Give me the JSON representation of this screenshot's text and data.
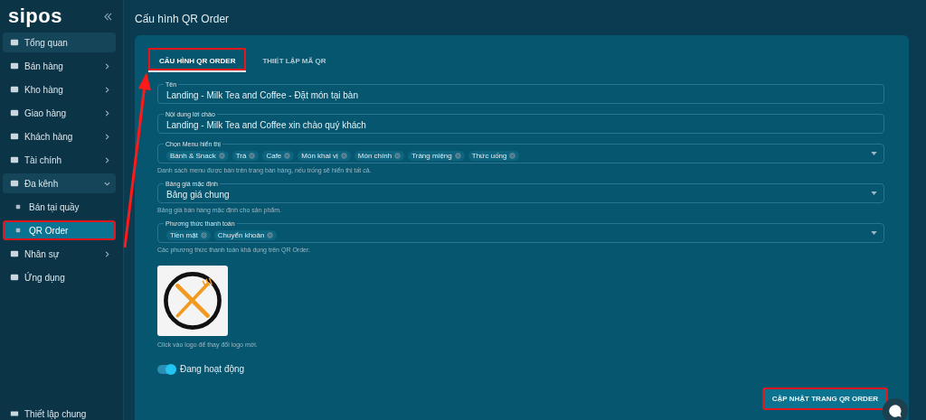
{
  "sidebar": {
    "logo": "sipos",
    "items": [
      {
        "label": "Tổng quan",
        "hovered": true,
        "has_children": false,
        "expanded": false,
        "selected": false,
        "highlighted": false
      },
      {
        "label": "Bán hàng",
        "hovered": false,
        "has_children": true,
        "expanded": false,
        "selected": false,
        "highlighted": false
      },
      {
        "label": "Kho hàng",
        "hovered": false,
        "has_children": true,
        "expanded": false,
        "selected": false,
        "highlighted": false
      },
      {
        "label": "Giao hàng",
        "hovered": false,
        "has_children": true,
        "expanded": false,
        "selected": false,
        "highlighted": false
      },
      {
        "label": "Khách hàng",
        "hovered": false,
        "has_children": true,
        "expanded": false,
        "selected": false,
        "highlighted": false
      },
      {
        "label": "Tài chính",
        "hovered": false,
        "has_children": true,
        "expanded": false,
        "selected": false,
        "highlighted": false
      },
      {
        "label": "Đa kênh",
        "hovered": false,
        "has_children": true,
        "expanded": true,
        "selected": false,
        "highlighted": false,
        "children": [
          {
            "label": "Bán tại quầy",
            "selected": false,
            "highlighted": false
          },
          {
            "label": "QR Order",
            "selected": true,
            "highlighted": true
          }
        ]
      },
      {
        "label": "Nhân sự",
        "hovered": false,
        "has_children": true,
        "expanded": false,
        "selected": false,
        "highlighted": false
      },
      {
        "label": "Ứng dụng",
        "hovered": false,
        "has_children": false,
        "expanded": false,
        "selected": false,
        "highlighted": false
      }
    ],
    "footer": "Thiết lập chung"
  },
  "page_title": "Cấu hình QR Order",
  "tabs": [
    {
      "label": "CẤU HÌNH QR ORDER",
      "selected": true,
      "highlighted": true
    },
    {
      "label": "THIẾT LẬP MÃ QR",
      "selected": false,
      "highlighted": false
    }
  ],
  "fields": [
    {
      "kind": "text",
      "label": "Tên",
      "value": "Landing - Milk Tea and Coffee - Đặt món tại bàn"
    },
    {
      "kind": "text",
      "label": "Nội dung lời chào",
      "value": "Landing - Milk Tea and Coffee xin chào quý khách"
    },
    {
      "kind": "tags",
      "label": "Chọn Menu hiển thị",
      "tags": [
        "Bánh & Snack",
        "Trà",
        "Cafe",
        "Món khai vị",
        "Món chính",
        "Tráng miệng",
        "Thức uống"
      ],
      "hint": "Danh sách menu được bán trên trang bán hàng, nếu trống sẽ hiển thị tất cả."
    },
    {
      "kind": "select",
      "label": "Bảng giá mặc định",
      "value": "Bảng giá chung",
      "hint": "Bảng giá bán hàng mặc định cho sản phẩm."
    },
    {
      "kind": "tags",
      "label": "Phương thức thanh toán",
      "tags": [
        "Tiền mặt",
        "Chuyển khoản"
      ],
      "hint": "Các phương thức thanh toán khả dụng trên QR Order."
    }
  ],
  "logo_hint": "Click vào logo để thay đổi logo mới.",
  "status_toggle": {
    "label": "Đang hoạt động",
    "on": true
  },
  "submit_button": {
    "label": "CẬP NHẬT TRANG QR ORDER",
    "highlighted": true
  }
}
